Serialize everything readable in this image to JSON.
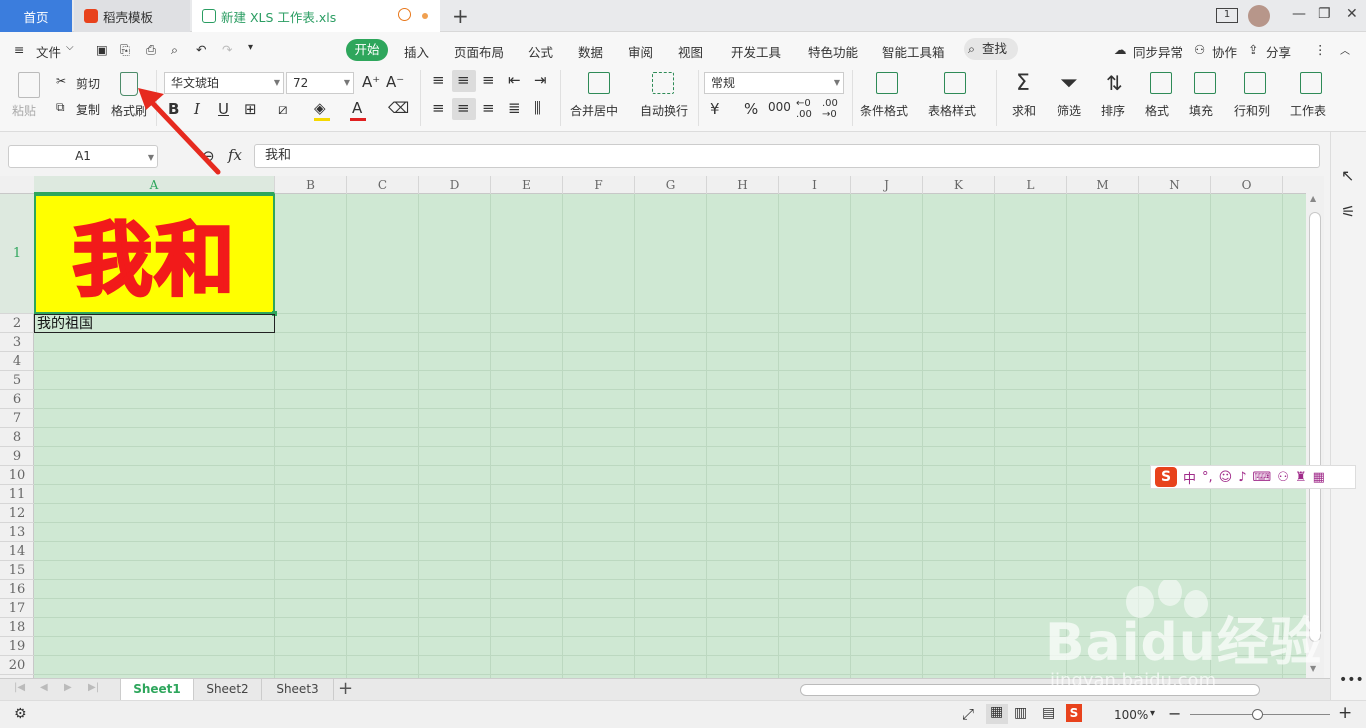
{
  "titlebar": {
    "tabs": [
      {
        "label": "首页"
      },
      {
        "label": "稻壳模板"
      },
      {
        "label": "新建 XLS 工作表.xls"
      }
    ],
    "add_tab": "+",
    "page_count": "1"
  },
  "menu": {
    "file": "文件",
    "items": [
      "开始",
      "插入",
      "页面布局",
      "公式",
      "数据",
      "审阅",
      "视图",
      "开发工具",
      "特色功能",
      "智能工具箱"
    ],
    "search": "查找",
    "sync": "同步异常",
    "collab": "协作",
    "share": "分享"
  },
  "ribbon": {
    "paste": "粘贴",
    "cut": "剪切",
    "copy": "复制",
    "format_painter": "格式刷",
    "font_name": "华文琥珀",
    "font_size": "72",
    "merge_center": "合并居中",
    "auto_wrap": "自动换行",
    "number_format": "常规",
    "currency": "¥",
    "percent": "%",
    "cond_format": "条件格式",
    "table_style": "表格样式",
    "sum": "求和",
    "filter": "筛选",
    "sort": "排序",
    "format": "格式",
    "fill": "填充",
    "row_col": "行和列",
    "worksheet": "工作表",
    "colors": {
      "font_color": "#e02020",
      "fill_color": "#f5d800"
    }
  },
  "formula_bar": {
    "name_box": "A1",
    "fx": "fx",
    "value": "我和"
  },
  "grid": {
    "columns": [
      "A",
      "B",
      "C",
      "D",
      "E",
      "F",
      "G",
      "H",
      "I",
      "J",
      "K",
      "L",
      "M",
      "N",
      "O"
    ],
    "rows": [
      "1",
      "2",
      "3",
      "4",
      "5",
      "6",
      "7",
      "8",
      "9",
      "10",
      "11",
      "12",
      "13",
      "14",
      "15",
      "16",
      "17",
      "18",
      "19",
      "20"
    ],
    "cells": {
      "A1": "我和",
      "A2": "我的祖国"
    },
    "colors": {
      "a1_background": "#ffff00",
      "a1_text": "#f21a1a",
      "selection": "#2ea65c",
      "eye_protect_bg": "#cfe8d3"
    }
  },
  "sheets": {
    "tabs": [
      "Sheet1",
      "Sheet2",
      "Sheet3"
    ],
    "active": "Sheet1",
    "add": "+"
  },
  "status": {
    "zoom": "100%"
  },
  "ime": {
    "logo": "S",
    "mode": "中"
  },
  "watermark": {
    "brand": "Baidu经验",
    "url": "jingyan.baidu.com"
  }
}
